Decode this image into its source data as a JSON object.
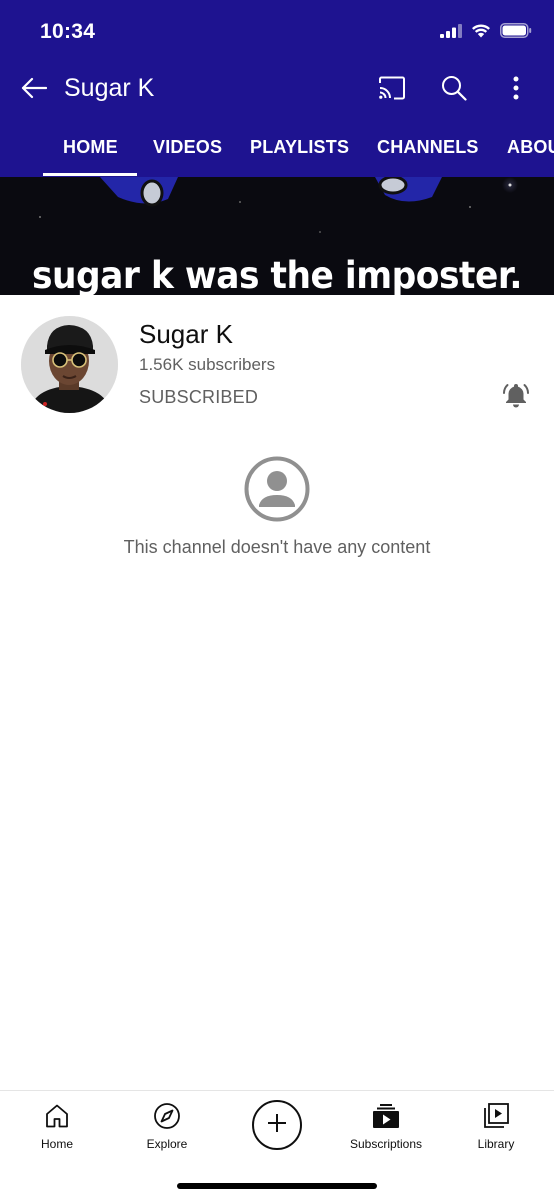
{
  "status_bar": {
    "time": "10:34"
  },
  "app_bar": {
    "title": "Sugar K",
    "icons": [
      "back-arrow-icon",
      "cast-icon",
      "search-icon",
      "more-vert-icon"
    ]
  },
  "tabs": [
    {
      "label": "HOME",
      "selected": true
    },
    {
      "label": "VIDEOS",
      "selected": false
    },
    {
      "label": "PLAYLISTS",
      "selected": false
    },
    {
      "label": "CHANNELS",
      "selected": false
    },
    {
      "label": "ABOUT",
      "selected": false
    }
  ],
  "banner": {
    "caption": "sugar k was the imposter."
  },
  "channel": {
    "name": "Sugar K",
    "subscribers": "1.56K subscribers",
    "subscribe_status": "SUBSCRIBED"
  },
  "empty_state": {
    "message": "This channel doesn't have any content"
  },
  "bottom_nav": {
    "items": [
      {
        "label": "Home",
        "icon": "home-icon"
      },
      {
        "label": "Explore",
        "icon": "compass-icon"
      },
      {
        "label": "Subscriptions",
        "icon": "subscriptions-icon"
      },
      {
        "label": "Library",
        "icon": "library-icon"
      }
    ],
    "create_icon": "plus-icon"
  },
  "colors": {
    "header_bg": "#1e1390",
    "banner_bg": "#0a0a10",
    "text_secondary": "#606060",
    "text_primary": "#0f0f0f"
  }
}
